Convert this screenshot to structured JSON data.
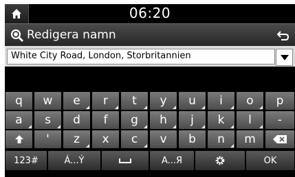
{
  "statusbar": {
    "time": "06:20"
  },
  "titlebar": {
    "title": "Redigera namn"
  },
  "input": {
    "value": "White City Road, London, Storbritannien"
  },
  "keyboard": {
    "row1": [
      "q",
      "w",
      "e",
      "r",
      "t",
      "y",
      "u",
      "i",
      "o",
      "p"
    ],
    "row2": [
      "a",
      "s",
      "d",
      "f",
      "g",
      "h",
      "j",
      "k",
      "l",
      "-"
    ],
    "row3": [
      "'",
      "z",
      "x",
      "c",
      "v",
      "b",
      "n",
      "m"
    ],
    "bottom": {
      "numeric": "123#",
      "accent": "Á...Ý",
      "alpha": "A...Я",
      "ok": "OK"
    }
  },
  "colors": {
    "background": "#000000",
    "key": "#5f5f5f",
    "text": "#ffffff"
  }
}
